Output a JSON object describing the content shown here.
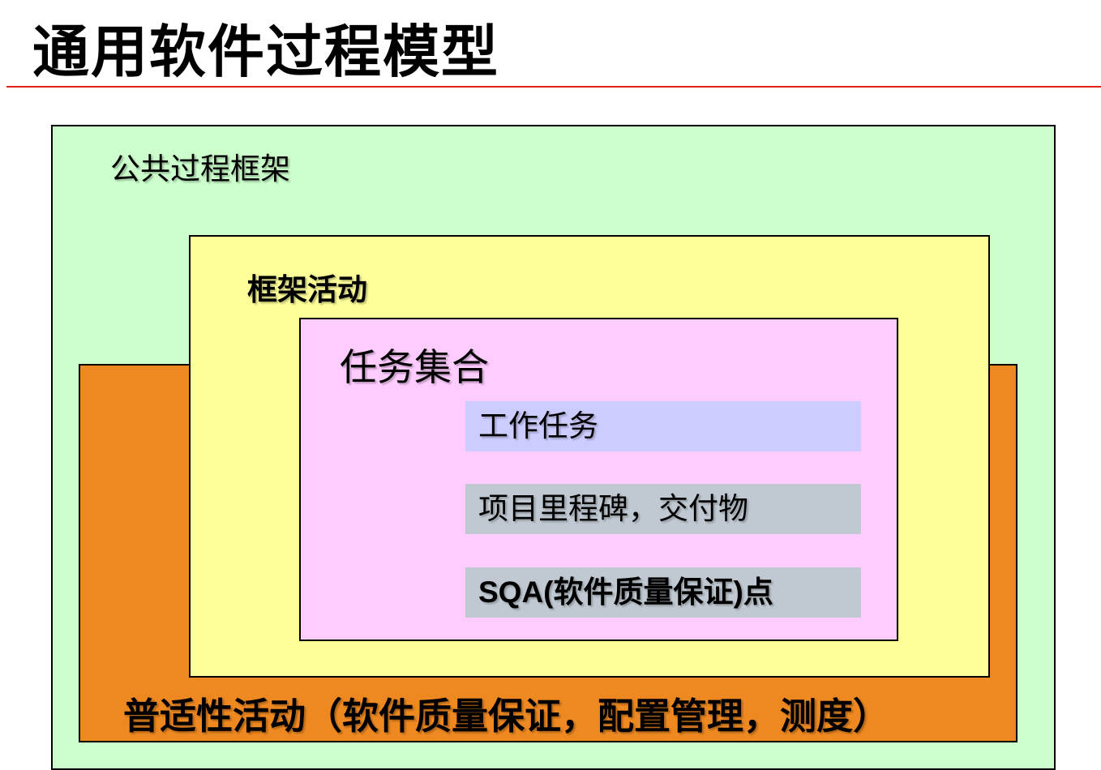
{
  "slide": {
    "title": "通用软件过程模型"
  },
  "diagram": {
    "public_framework": {
      "label": "公共过程框架",
      "color": "#ccffcc"
    },
    "umbrella_activities": {
      "label": "普适性活动（软件质量保证，配置管理，测度）",
      "color": "#ee8820"
    },
    "framework_activities": {
      "label": "框架活动",
      "color": "#ffff99"
    },
    "task_set": {
      "label": "任务集合",
      "color": "#ffccff",
      "items": [
        {
          "text": "工作任务",
          "color": "#ccccff"
        },
        {
          "text": "项目里程碑，交付物",
          "color": "#c0c9d2"
        },
        {
          "text_prefix": "SQA(",
          "text_middle": "软件质量保证",
          "text_suffix": ")点",
          "color": "#c0c9d2"
        }
      ]
    },
    "title_rule_color": "#e8201c"
  }
}
